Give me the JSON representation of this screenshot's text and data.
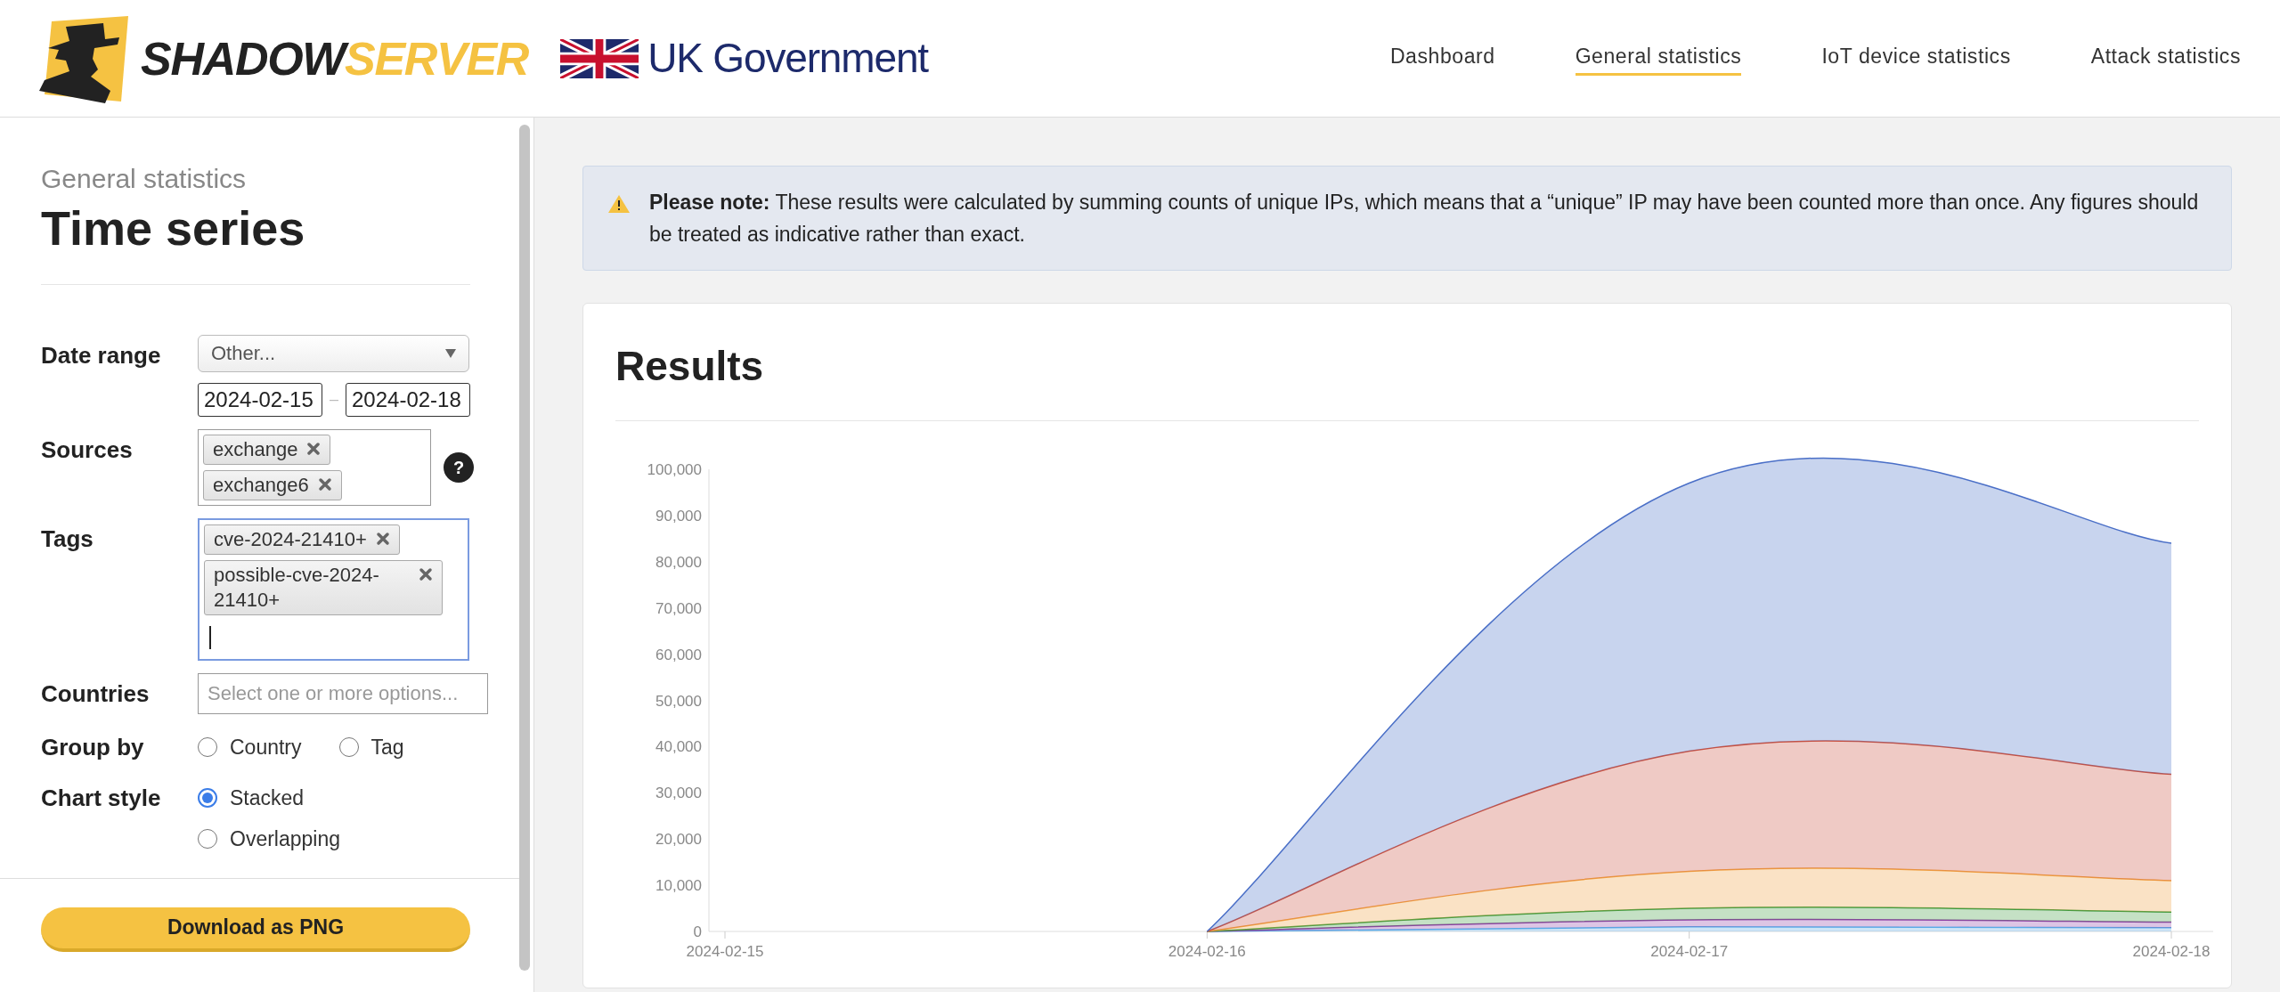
{
  "header": {
    "brand": {
      "wordmark": [
        "SHADOW",
        "SERVER"
      ]
    },
    "partner": {
      "text": "UK Government"
    },
    "nav": [
      {
        "label": "Dashboard",
        "selected": false
      },
      {
        "label": "General statistics",
        "selected": true
      },
      {
        "label": "IoT device statistics",
        "selected": false
      },
      {
        "label": "Attack statistics",
        "selected": false
      }
    ]
  },
  "sidebar": {
    "breadcrumb": "General statistics",
    "title": "Time series",
    "fields": [
      {
        "kind": "date_range",
        "label": "Date range",
        "select": "Other...",
        "from": "2024-02-15",
        "separator": "–",
        "to": "2024-02-18"
      },
      {
        "kind": "tags",
        "label": "Sources",
        "focused": false,
        "help": "?",
        "tags": [
          "exchange",
          "exchange6"
        ]
      },
      {
        "kind": "tags",
        "label": "Tags",
        "focused": true,
        "tags": [
          "cve-2024-21410+",
          "possible-cve-2024-21410+"
        ]
      },
      {
        "kind": "text",
        "label": "Countries",
        "placeholder": "Select one or more options..."
      },
      {
        "kind": "radio",
        "label": "Group by",
        "options": [
          {
            "label": "Country",
            "selected": false
          },
          {
            "label": "Tag",
            "selected": false
          }
        ]
      },
      {
        "kind": "radio",
        "label": "Chart style",
        "options": [
          {
            "label": "Stacked",
            "selected": true
          },
          {
            "label": "Overlapping",
            "selected": false
          }
        ]
      }
    ],
    "download_button": "Download as PNG"
  },
  "notice": {
    "text": "**Please note:** These results were calculated by summing counts of unique IPs, which means that a “unique” IP may have been counted more than once. Any figures should be treated as indicative rather than exact."
  },
  "results": {
    "title": "Results",
    "chart_data": {
      "type": "area",
      "stacked": true,
      "categories": [
        "2024-02-15",
        "2024-02-16",
        "2024-02-17",
        "2024-02-18"
      ],
      "ylim": [
        0,
        100000
      ],
      "yticks": [
        {
          "value": 0,
          "label": "0"
        },
        {
          "value": 10000,
          "label": "10,000"
        },
        {
          "value": 20000,
          "label": "20,000"
        },
        {
          "value": 30000,
          "label": "30,000"
        },
        {
          "value": 40000,
          "label": "40,000"
        },
        {
          "value": 50000,
          "label": "50,000"
        },
        {
          "value": 60000,
          "label": "60,000"
        },
        {
          "value": 70000,
          "label": "70,000"
        },
        {
          "value": 80000,
          "label": "80,000"
        },
        {
          "value": 90000,
          "label": "90,000"
        },
        {
          "value": 100000,
          "label": "100,000"
        }
      ],
      "series": [
        {
          "color": "#5aa9e6",
          "values": [
            null,
            0,
            1000,
            800
          ]
        },
        {
          "color": "#8e3ea5",
          "values": [
            null,
            0,
            1500,
            1200
          ]
        },
        {
          "color": "#3e9a3e",
          "values": [
            null,
            0,
            2500,
            2200
          ]
        },
        {
          "color": "#f0a040",
          "values": [
            null,
            0,
            8000,
            6800
          ]
        },
        {
          "color": "#c9503f",
          "values": [
            null,
            0,
            26000,
            23000
          ]
        },
        {
          "color": "#4a6fc7",
          "values": [
            null,
            0,
            58000,
            50000
          ]
        }
      ]
    }
  }
}
